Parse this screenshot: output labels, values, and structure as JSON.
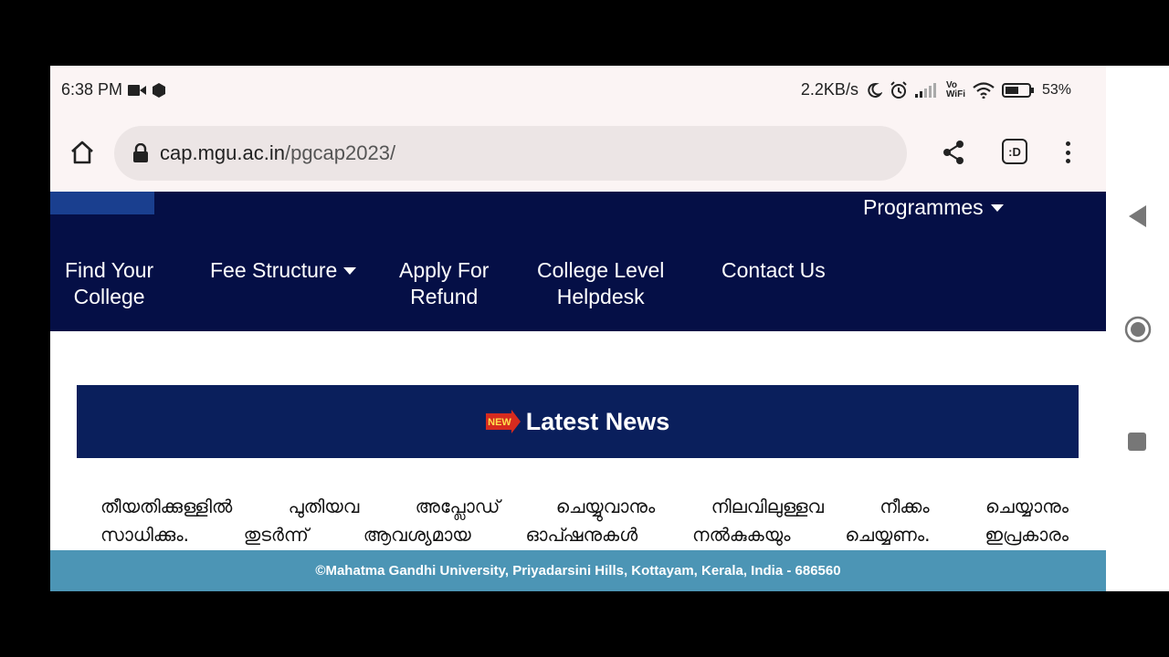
{
  "status_bar": {
    "time": "6:38 PM",
    "speed": "2.2KB/s",
    "volte": "Vo\nWiFi",
    "battery": "53%"
  },
  "browser": {
    "url_domain": "cap.mgu.ac.in",
    "url_path": "/pgcap2023/",
    "tab_label": ":D"
  },
  "nav": {
    "programmes": "Programmes",
    "items": [
      {
        "line1": "Find Your",
        "line2": "College"
      },
      {
        "line1": "Fee Structure",
        "line2": ""
      },
      {
        "line1": "Apply For",
        "line2": "Refund"
      },
      {
        "line1": "College Level",
        "line2": "Helpdesk"
      },
      {
        "line1": "Contact Us",
        "line2": ""
      }
    ]
  },
  "news": {
    "badge": "NEW",
    "title": "Latest News",
    "line1": "തീയതിക്കുള്ളിൽ പുതിയവ അപ്ലോഡ് ചെയ്യുവാനും നിലവിലുള്ളവ നീക്കം ചെയ്യാനും",
    "line2": "സാധിക്കും. തുടർന്ന് ആവശ്യമായ ഓപ്ഷനുകൾ നൽകുകയും ചെയ്യണം. ഇപ്രകാരം"
  },
  "footer": {
    "text": "©Mahatma Gandhi University, Priyadarsini Hills, Kottayam, Kerala, India - 686560"
  },
  "colors": {
    "nav_bg": "#050f46",
    "news_bar": "#0a1f5c",
    "footer_bg": "#4c95b5"
  }
}
